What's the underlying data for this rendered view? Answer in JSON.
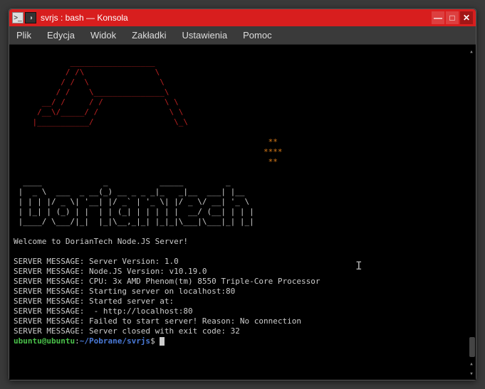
{
  "window": {
    "title": "svrjs : bash — Konsola"
  },
  "menu": {
    "file": "Plik",
    "edit": "Edycja",
    "view": "Widok",
    "bookmarks": "Zakładki",
    "settings": "Ustawienia",
    "help": "Pomoc"
  },
  "terminal": {
    "ascii_roof": "             _____                      ",
    "ascii_roof_lines": [
      "     / /\\   ",
      "    / /  \\  ",
      "   / / /\\ \\ ",
      "  /_/ /  \\ \\",
      "  \\ \\ \\   \\_\\",
      "   \\ \\ \\    ",
      "    \\ \\ \\   ",
      "     \\_\\/   "
    ],
    "roof_art": "            __________________\n           / /\\               \\\n          / /  \\               \\\n         / /    \\_______________\\\n      __/ /     / /             \\ \\\n     /__\\/_____/ /               \\ \\\n    |___________/                 \\_\\",
    "stars1": "                                                      **",
    "stars2": "                                                     ****",
    "stars3": "                                                      **",
    "big_text_lines": [
      "  ____             _           _____         _",
      " |  _ \\  ___  _ __(_) __ _ _ _|_   _|__  ___| |__",
      " | | | |/ _ \\| '__| |/ _` | '_ \\| |/ _ \\/ __| '_ \\",
      " | |_| | (_) | |  | | (_| | | | | |  __/ (__| | | |",
      " |____/ \\___/|_|  |_|\\__,_|_| |_|_|\\___|\\___|_| |_|"
    ],
    "welcome": "Welcome to DorianTech Node.JS Server!",
    "messages": [
      "SERVER MESSAGE: Server Version: 1.0",
      "SERVER MESSAGE: Node.JS Version: v10.19.0",
      "SERVER MESSAGE: CPU: 3x AMD Phenom(tm) 8550 Triple-Core Processor",
      "SERVER MESSAGE: Starting server on localhost:80",
      "SERVER MESSAGE: Started server at:",
      "SERVER MESSAGE:  - http://localhost:80",
      "SERVER MESSAGE: Failed to start server! Reason: No connection",
      "SERVER MESSAGE: Server closed with exit code: 32"
    ],
    "prompt_user": "ubuntu@ubuntu",
    "prompt_colon": ":",
    "prompt_path": "~/Pobrane/svrjs",
    "prompt_dollar": "$ "
  },
  "window_buttons": {
    "minimize": "—",
    "maximize": "□",
    "close": "✕"
  }
}
